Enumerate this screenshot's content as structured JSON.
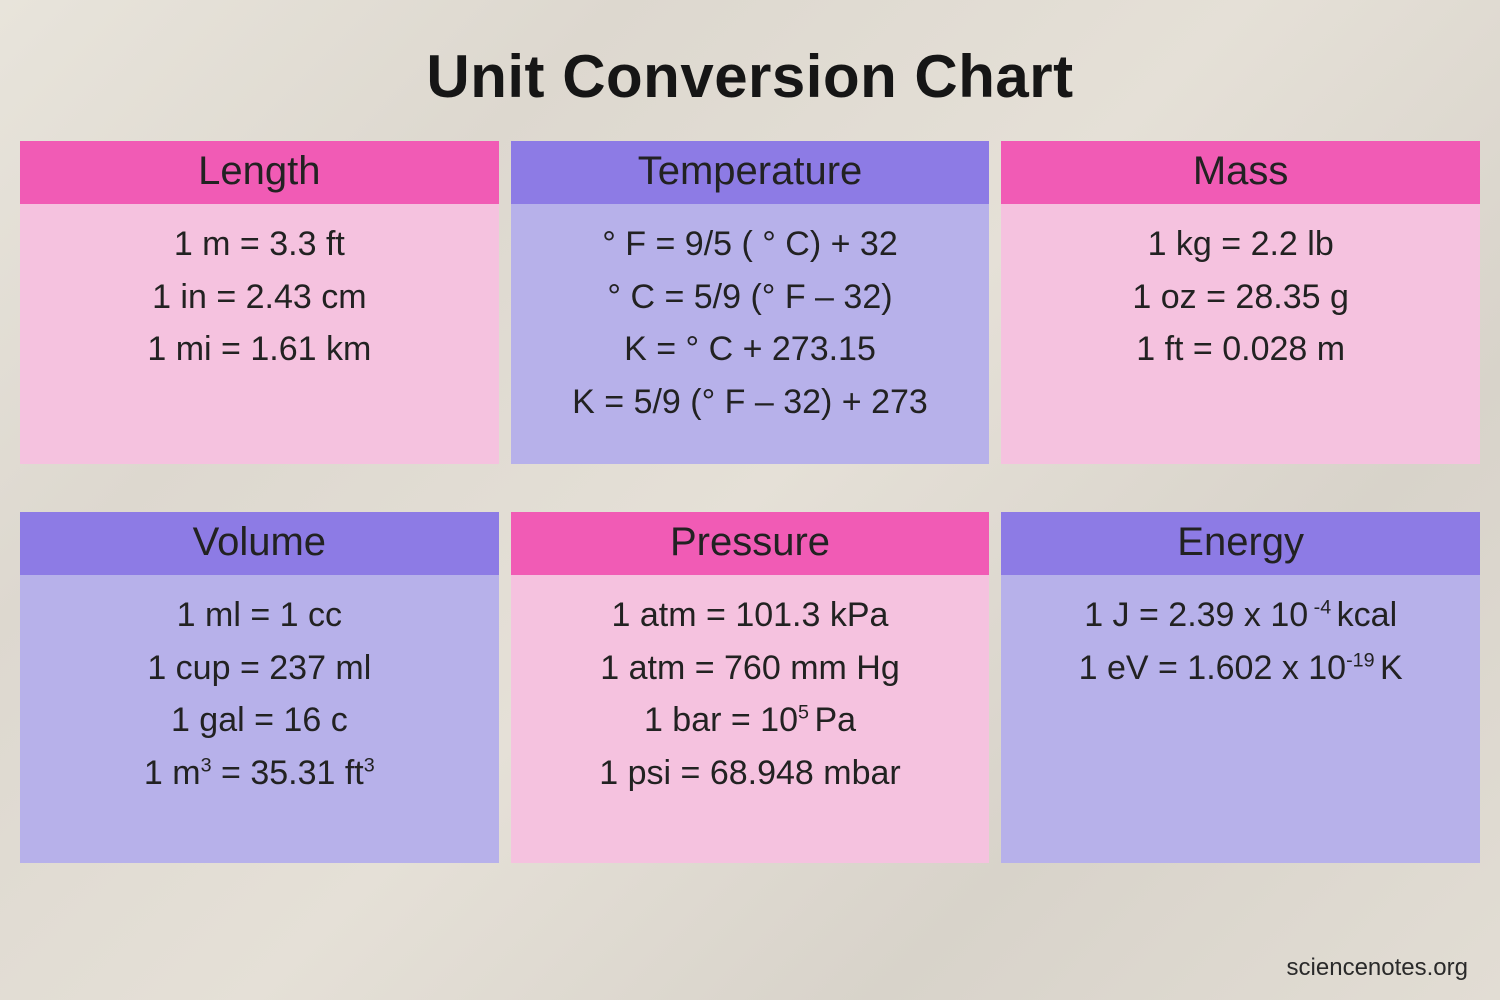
{
  "title": "Unit Conversion Chart",
  "attribution": "sciencenotes.org",
  "sections": {
    "length": {
      "header": "Length",
      "rows": [
        "1 m = 3.3 ft",
        "1 in = 2.43 cm",
        "1 mi = 1.61 km"
      ]
    },
    "temperature": {
      "header": "Temperature",
      "rows": [
        "° F = 9/5 ( ° C) + 32",
        "° C = 5/9 (° F – 32)",
        "K = ° C + 273.15",
        "K = 5/9 (° F – 32) + 273"
      ]
    },
    "mass": {
      "header": "Mass",
      "rows": [
        "1  kg = 2.2 lb",
        "1 oz = 28.35 g",
        "1 ft  = 0.028 m"
      ]
    },
    "volume": {
      "header": "Volume",
      "rows_html": [
        "1  ml = 1 cc",
        "1 cup = 237 ml",
        "1 gal = 16 c",
        "1 m<sup>3</sup>  = 35.31 ft<sup>3</sup>"
      ]
    },
    "pressure": {
      "header": "Pressure",
      "rows_html": [
        "1 atm = 101.3 kPa",
        "1 atm = 760 mm Hg",
        "1 bar = 10<sup>5 </sup>Pa",
        "1 psi = 68.948 mbar"
      ]
    },
    "energy": {
      "header": "Energy",
      "rows_html": [
        "1 J = 2.39 x 10<sup> -4 </sup>kcal",
        "1 eV = 1.602 x 10<sup>-19 </sup>K"
      ]
    }
  }
}
